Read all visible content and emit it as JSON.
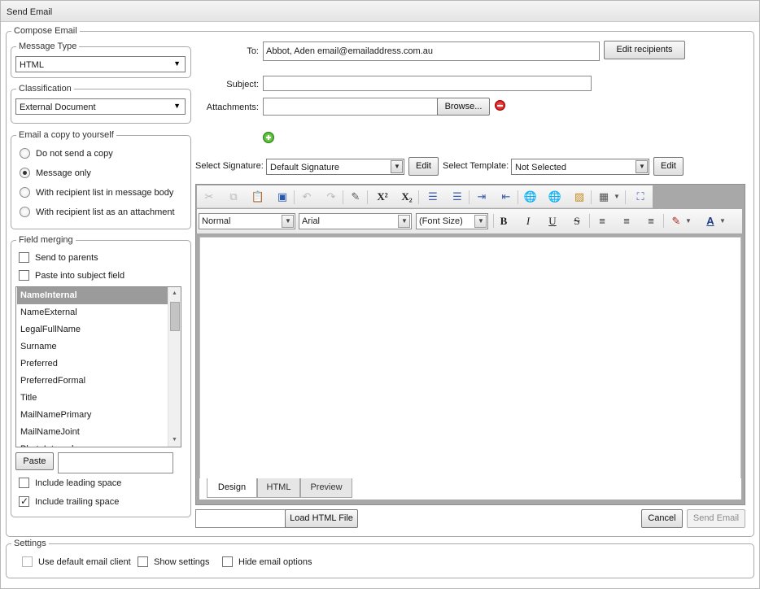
{
  "window": {
    "title": "Send Email"
  },
  "compose": {
    "legend": "Compose Email",
    "message_type": {
      "legend": "Message Type",
      "value": "HTML"
    },
    "classification": {
      "legend": "Classification",
      "value": "External Document"
    },
    "copy": {
      "legend": "Email a copy to yourself",
      "options": [
        {
          "label": "Do not send a copy",
          "selected": false
        },
        {
          "label": "Message only",
          "selected": true
        },
        {
          "label": "With recipient list in message body",
          "selected": false
        },
        {
          "label": "With recipient list as an attachment",
          "selected": false
        }
      ]
    },
    "field_merging": {
      "legend": "Field merging",
      "send_to_parents": {
        "label": "Send to parents",
        "checked": false
      },
      "paste_subject": {
        "label": "Paste into subject field",
        "checked": false
      },
      "fields": [
        "NameInternal",
        "NameExternal",
        "LegalFullName",
        "Surname",
        "Preferred",
        "PreferredFormal",
        "Title",
        "MailNamePrimary",
        "MailNameJoint",
        "PhotoInternal"
      ],
      "selected_field": "NameInternal",
      "paste_button": "Paste",
      "paste_value": "",
      "leading_space": {
        "label": "Include leading space",
        "checked": false
      },
      "trailing_space": {
        "label": "Include trailing space",
        "checked": true
      }
    },
    "to": {
      "label": "To:",
      "value": "Abbot, Aden email@emailaddress.com.au",
      "button": "Edit recipients"
    },
    "subject": {
      "label": "Subject:",
      "value": ""
    },
    "attachments": {
      "label": "Attachments:",
      "value": "",
      "browse": "Browse..."
    },
    "signature": {
      "label": "Select Signature:",
      "value": "Default Signature",
      "edit": "Edit"
    },
    "template": {
      "label": "Select Template:",
      "value": "Not Selected",
      "edit": "Edit"
    },
    "editor": {
      "toolbar_row1": [
        "cut-icon",
        "copy-icon",
        "paste-icon",
        "paste-from-word-icon",
        "undo-icon",
        "redo-icon",
        "spellcheck-icon",
        "superscript-icon",
        "subscript-icon",
        "ordered-list-icon",
        "unordered-list-icon",
        "indent-icon",
        "outdent-icon",
        "insert-link-icon",
        "remove-link-icon",
        "insert-image-icon",
        "insert-table-icon",
        "fullscreen-icon"
      ],
      "superscript_glyph": "X²",
      "subscript_glyph": "X₂",
      "format_select": "Normal",
      "font_select": "Arial",
      "size_select": "(Font Size)",
      "bold_glyph": "B",
      "italic_glyph": "I",
      "underline_glyph": "U",
      "strike_glyph": "S",
      "forecolor_glyph": "A",
      "tabs": [
        "Design",
        "HTML",
        "Preview"
      ],
      "active_tab": "Design"
    },
    "load_html": {
      "value": "",
      "button": "Load HTML File"
    },
    "cancel_button": "Cancel",
    "send_button": "Send Email"
  },
  "settings": {
    "legend": "Settings",
    "use_default_client": {
      "label": "Use default email client",
      "checked": false
    },
    "show_settings": {
      "label": "Show settings",
      "checked": false
    },
    "hide_email_options": {
      "label": "Hide email options",
      "checked": false
    }
  }
}
